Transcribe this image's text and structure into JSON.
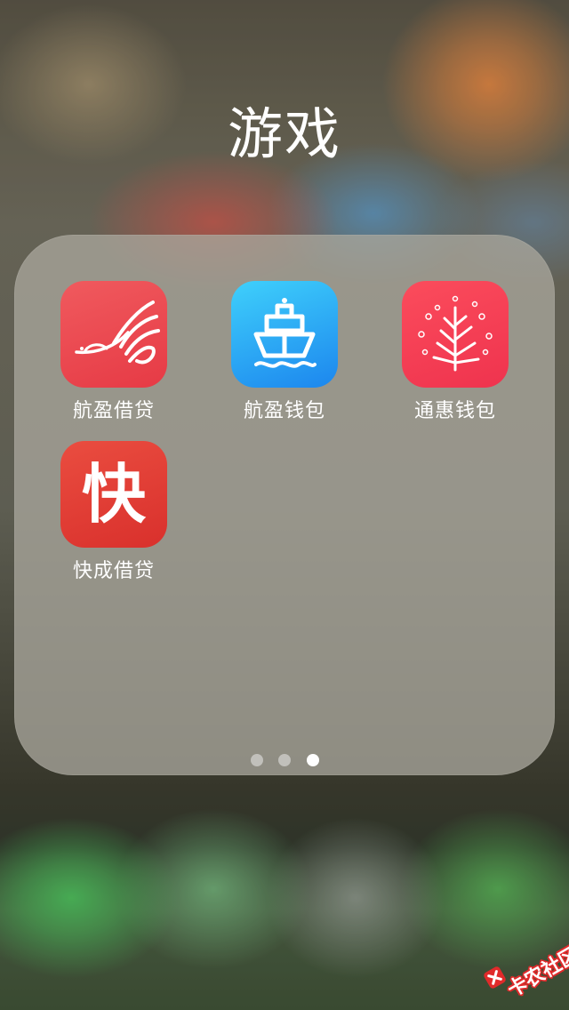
{
  "folder": {
    "title": "游戏"
  },
  "apps": [
    {
      "label": "航盈借贷",
      "icon": "red-bird-logo-icon",
      "color": "#e63a45"
    },
    {
      "label": "航盈钱包",
      "icon": "blue-ship-logo-icon",
      "color": "#1c86ee"
    },
    {
      "label": "通惠钱包",
      "icon": "pink-tree-logo-icon",
      "color": "#ef334e"
    },
    {
      "label": "快成借贷",
      "icon": "kuai-character-logo-icon",
      "glyph": "快",
      "color": "#d9302c"
    }
  ],
  "page_indicator": {
    "pages": 3,
    "current": 3
  },
  "watermark": {
    "text": "卡农社区"
  }
}
